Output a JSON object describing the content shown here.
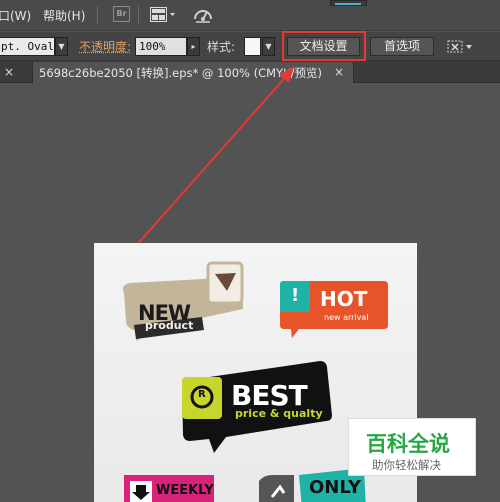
{
  "menubar": {
    "window_menu": "口(W)",
    "help_menu": "帮助(H)",
    "bridge_label": "Br"
  },
  "controlbar": {
    "stroke_value": "pt. Oval",
    "opacity_label": "不透明度:",
    "opacity_value": "100%",
    "style_label": "样式:",
    "doc_setup_button": "文档设置",
    "preferences_button": "首选项"
  },
  "tabbar": {
    "close_glyph": "×",
    "doc_tab_label": "5698c26be2050 [转换].eps* @ 100% (CMYK/预览)"
  },
  "artboard": {
    "sticker_new": "NEW",
    "sticker_product": "product",
    "sticker_hot": "HOT",
    "sticker_new_arrival": "new arrival",
    "sticker_exclaim": "!",
    "sticker_r": "R",
    "sticker_best": "BEST",
    "sticker_price_quality": "price & qualty",
    "sticker_weekly": "WEEKLY",
    "sticker_only": "ONLY"
  },
  "watermark": {
    "title": "百科全说",
    "subtitle": "助你轻松解决"
  },
  "colors": {
    "highlight_red": "#e53935",
    "hot_orange": "#e8542a",
    "hot_teal": "#1fb3a8",
    "best_green": "#c8d62b",
    "watermark_green": "#27a844"
  }
}
